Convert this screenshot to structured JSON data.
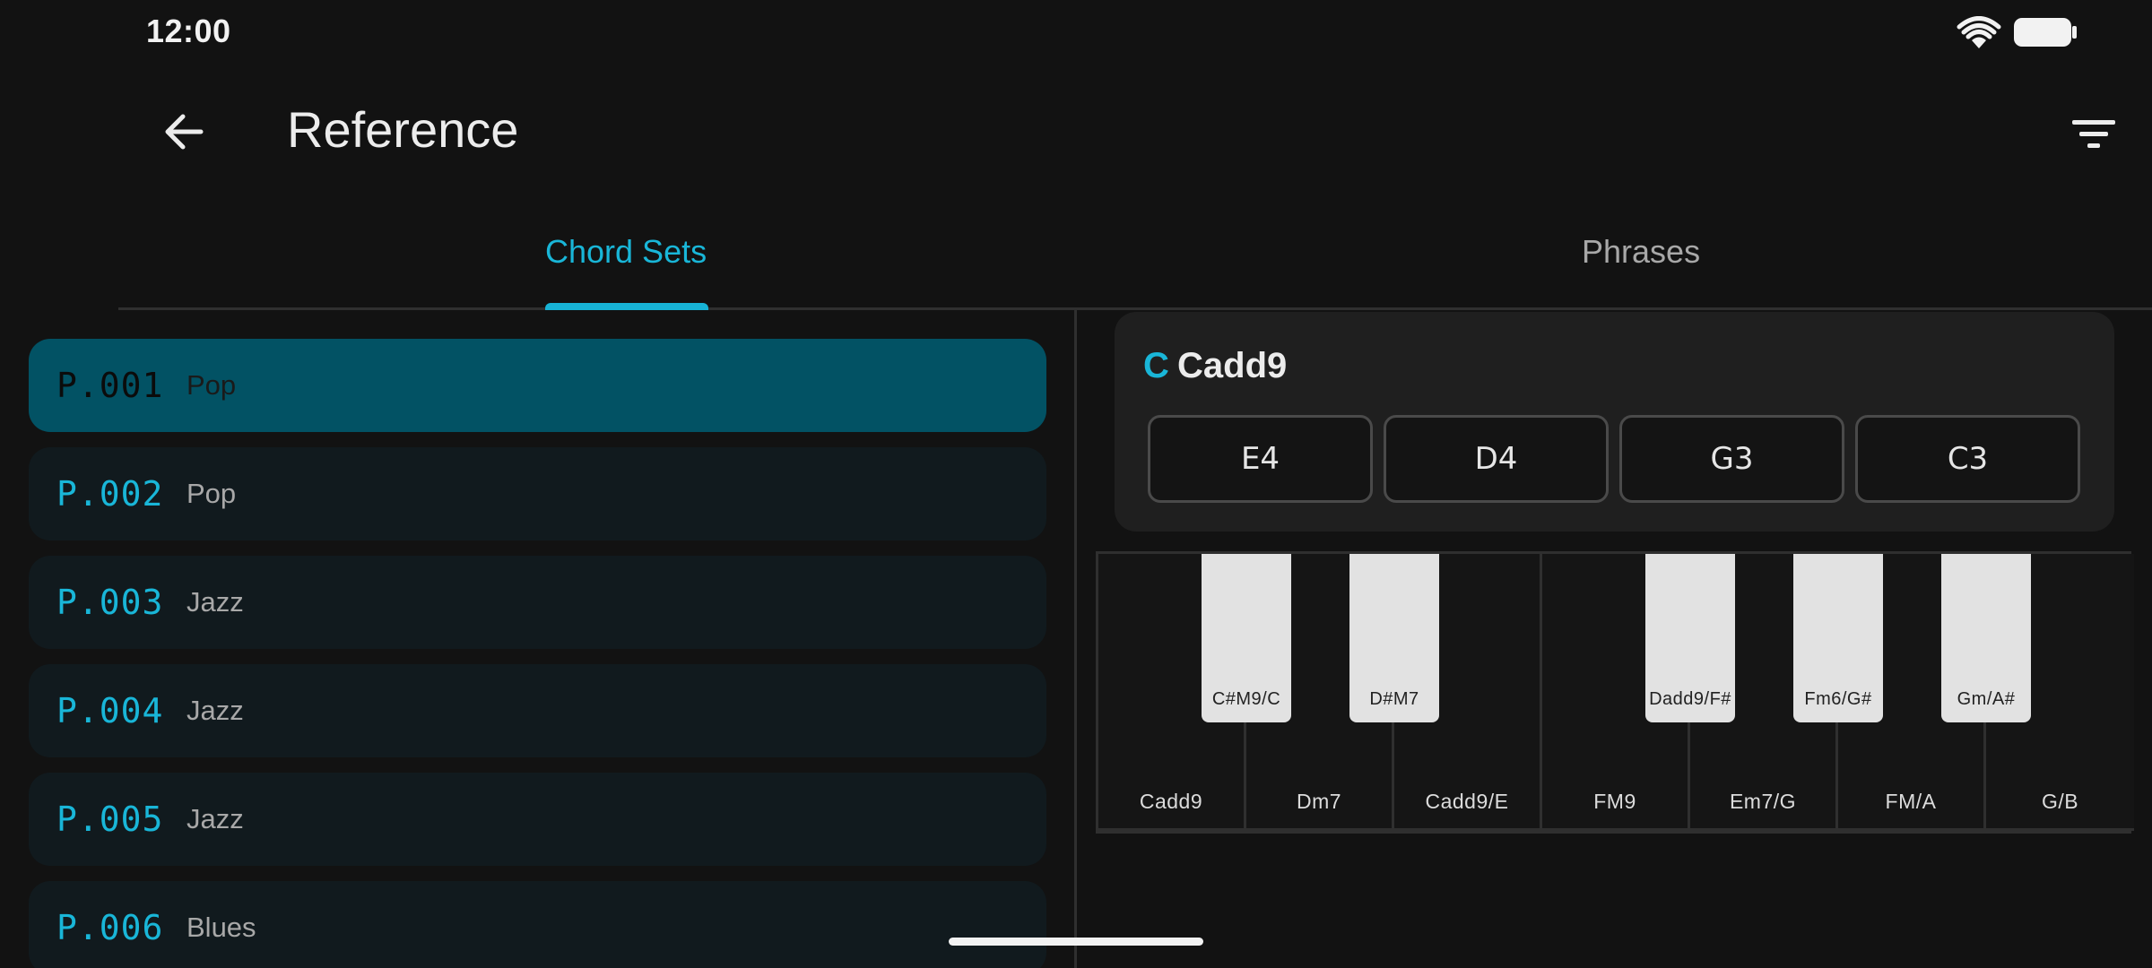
{
  "status": {
    "time": "12:00"
  },
  "header": {
    "title": "Reference"
  },
  "tabs": [
    {
      "label": "Chord Sets",
      "active": true
    },
    {
      "label": "Phrases",
      "active": false
    }
  ],
  "list": [
    {
      "code": "P.001",
      "genre": "Pop",
      "selected": true
    },
    {
      "code": "P.002",
      "genre": "Pop"
    },
    {
      "code": "P.003",
      "genre": "Jazz"
    },
    {
      "code": "P.004",
      "genre": "Jazz"
    },
    {
      "code": "P.005",
      "genre": "Jazz"
    },
    {
      "code": "P.006",
      "genre": "Blues"
    }
  ],
  "chord": {
    "root": "C",
    "name": "Cadd9",
    "notes": [
      "E4",
      "D4",
      "G3",
      "C3"
    ]
  },
  "keyboard": {
    "white_keys": [
      "Cadd9",
      "Dm7",
      "Cadd9/E",
      "FM9",
      "Em7/G",
      "FM/A",
      "G/B"
    ],
    "black_keys": [
      "C#M9/C",
      "D#M7",
      "Dadd9/F#",
      "Fm6/G#",
      "Gm/A#"
    ]
  },
  "colors": {
    "accent": "#19b6d8",
    "selected_row": "#025264",
    "row_bg": "#111a1e",
    "background": "#121212"
  },
  "icons": {
    "back": "arrow-left-icon",
    "filter": "filter-icon",
    "wifi": "wifi-icon",
    "battery": "battery-icon"
  }
}
